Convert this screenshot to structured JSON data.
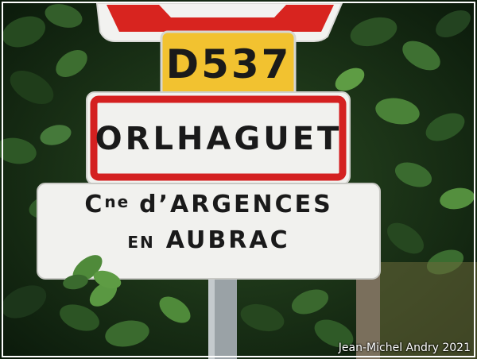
{
  "road_sign": {
    "number": "D537",
    "background": "#f2c230"
  },
  "town_sign": {
    "name": "ORLHAGUET",
    "border_color": "#d42020"
  },
  "commune_sign": {
    "line1_prefix": "C",
    "line1_superscript": "ne",
    "line1_rest": "d’ARGENCES",
    "line2_small": "EN",
    "line2_rest": "AUBRAC"
  },
  "photo_credit": "Jean-Michel Andry 2021",
  "colors": {
    "foliage_dark": "#0f2410",
    "foliage_light": "#4f8a3a",
    "sign_white": "#f1f1ee"
  }
}
